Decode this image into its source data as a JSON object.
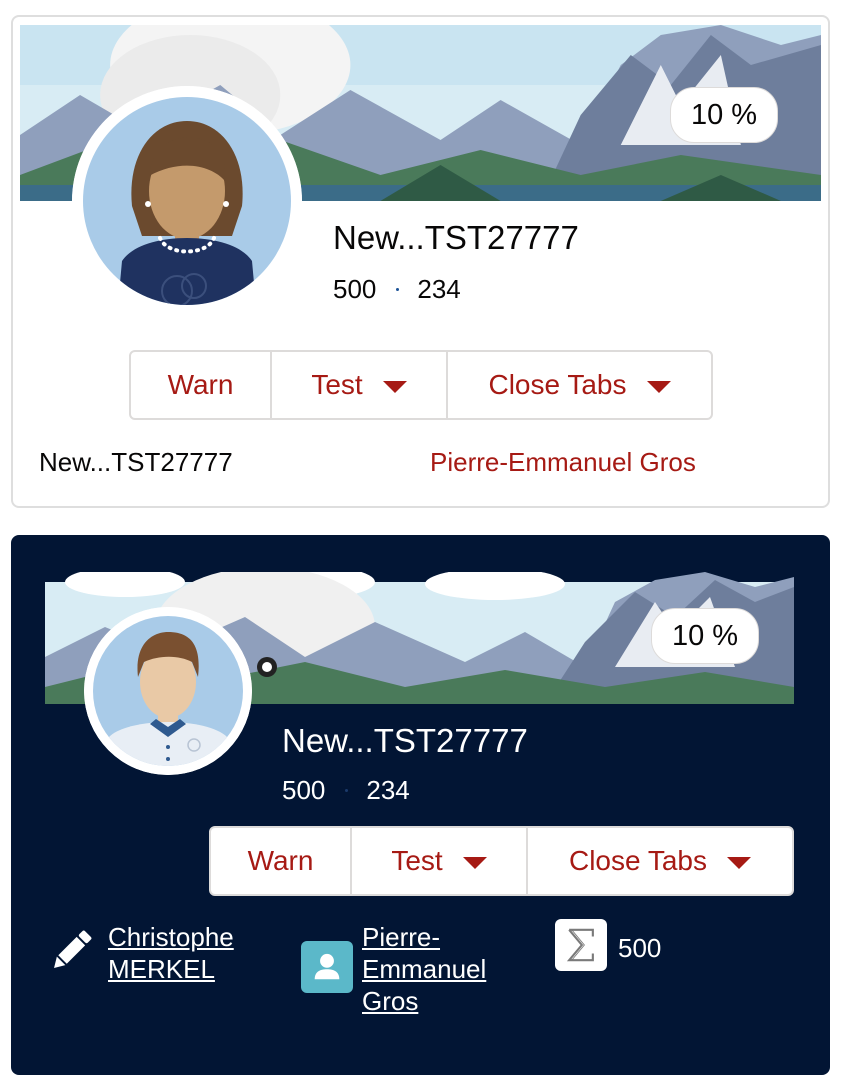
{
  "cards": [
    {
      "percent": "10 %",
      "title": "New...TST27777",
      "stat_a": "500",
      "stat_b": "234",
      "buttons": {
        "warn": "Warn",
        "test": "Test",
        "close_tabs": "Close Tabs"
      },
      "footer_name": "New...TST27777",
      "footer_link": "Pierre-Emmanuel Gros"
    },
    {
      "percent": "10 %",
      "title": "New...TST27777",
      "stat_a": "500",
      "stat_b": "234",
      "buttons": {
        "warn": "Warn",
        "test": "Test",
        "close_tabs": "Close Tabs"
      },
      "owner_line1": "Christophe",
      "owner_line2": "MERKEL",
      "contact_line1": "Pierre-",
      "contact_line2": "Emmanuel",
      "contact_line3": "Gros",
      "sum_value": "500"
    }
  ],
  "icons": {
    "dropdown": "chevron-down-icon",
    "edit": "pencil-icon",
    "contact": "user-icon",
    "sum": "sigma-icon"
  },
  "colors": {
    "brand_red": "#a61a14",
    "dark_navy": "#021534",
    "contact_teal": "#5bb8c9"
  }
}
